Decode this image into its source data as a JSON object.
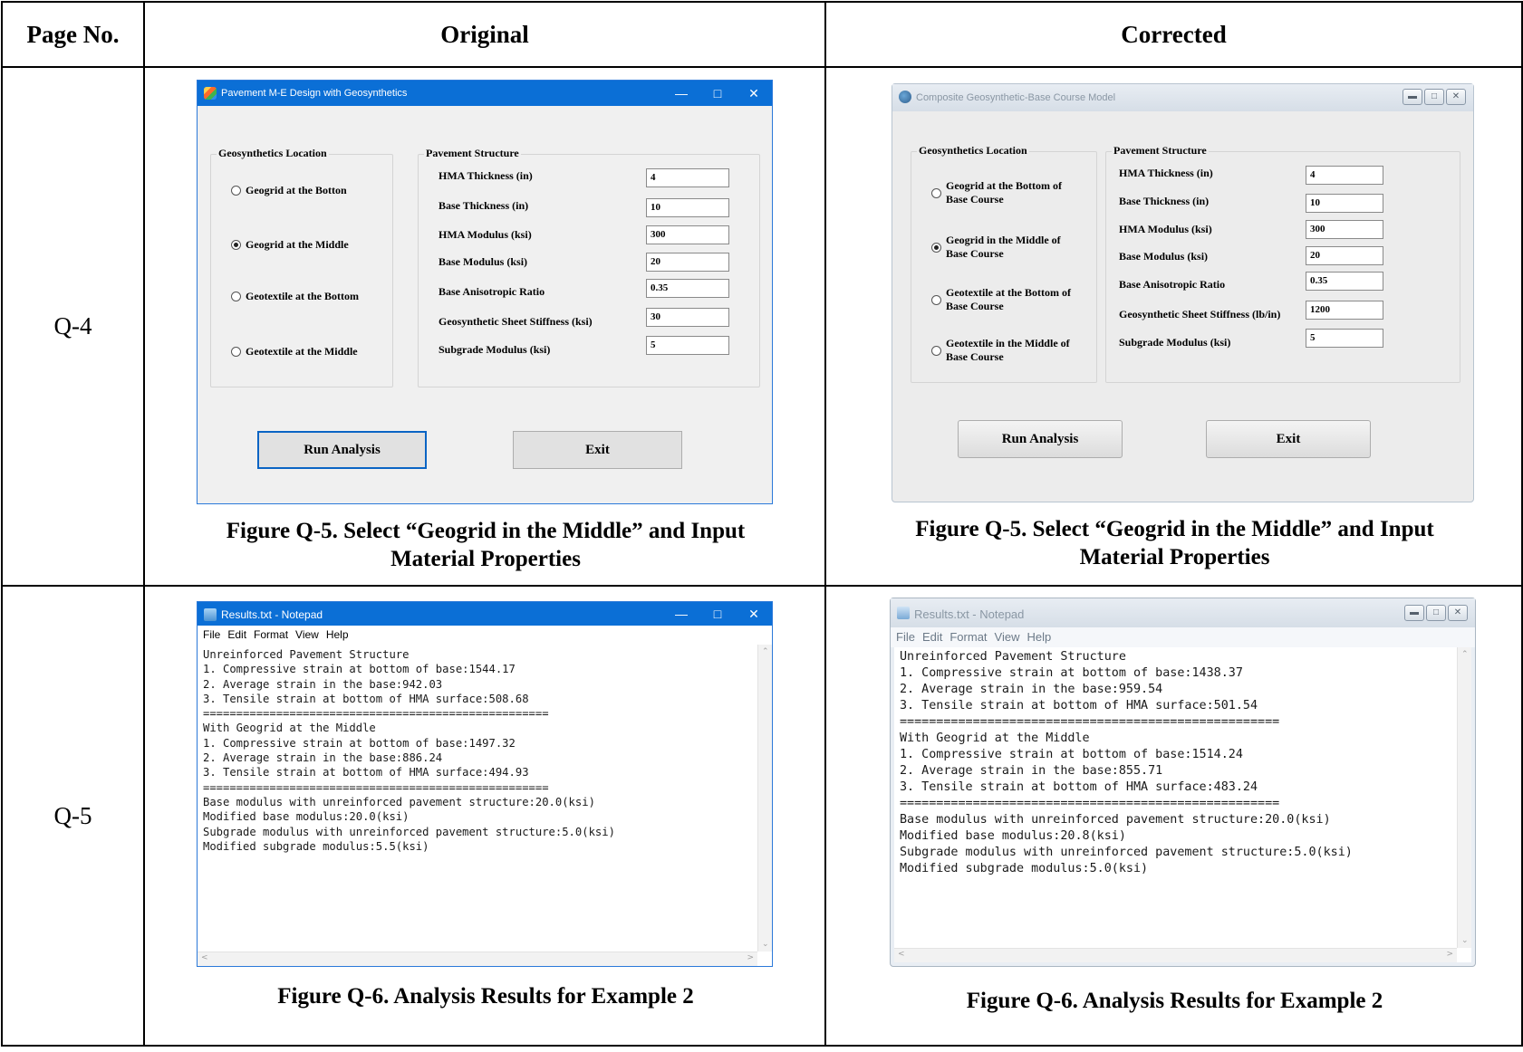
{
  "headers": {
    "page_no": "Page No.",
    "original": "Original",
    "corrected": "Corrected"
  },
  "rows": [
    {
      "page": "Q-4",
      "original": {
        "window_title": "Pavement M-E Design with Geosynthetics",
        "location_group": "Geosynthetics Location",
        "options": [
          "Geogrid at the Botton",
          "Geogrid at the Middle",
          "Geotextile at the Bottom",
          "Geotextile at the Middle"
        ],
        "selected_index": 1,
        "structure_group": "Pavement Structure",
        "labels": [
          "HMA Thickness (in)",
          "Base Thickness (in)",
          "HMA Modulus (ksi)",
          "Base Modulus (ksi)",
          "Base Anisotropic Ratio",
          "Geosynthetic Sheet Stiffness (ksi)",
          "Subgrade Modulus (ksi)"
        ],
        "values": [
          "4",
          "10",
          "300",
          "20",
          "0.35",
          "30",
          "5"
        ],
        "run_button": "Run Analysis",
        "exit_button": "Exit",
        "caption_line1": "Figure Q-5. Select “Geogrid in the Middle” and Input",
        "caption_line2": "Material Properties"
      },
      "corrected": {
        "window_title": "Composite Geosynthetic-Base Course Model",
        "location_group": "Geosynthetics Location",
        "options": [
          [
            "Geogrid at the Bottom of",
            "Base Course"
          ],
          [
            "Geogrid in the Middle of",
            "Base Course"
          ],
          [
            "Geotextile at the Bottom of",
            "Base Course"
          ],
          [
            "Geotextile in the Middle of",
            "Base Course"
          ]
        ],
        "selected_index": 1,
        "structure_group": "Pavement Structure",
        "labels": [
          "HMA Thickness (in)",
          "Base Thickness (in)",
          "HMA Modulus (ksi)",
          "Base Modulus (ksi)",
          "Base Anisotropic Ratio",
          "Geosynthetic Sheet Stiffness (lb/in)",
          "Subgrade Modulus (ksi)"
        ],
        "values": [
          "4",
          "10",
          "300",
          "20",
          "0.35",
          "1200",
          "5"
        ],
        "run_button": "Run Analysis",
        "exit_button": "Exit",
        "caption_line1": "Figure Q-5. Select “Geogrid in the Middle” and Input",
        "caption_line2": "Material Properties"
      }
    },
    {
      "page": "Q-5",
      "original": {
        "window_title": "Results.txt - Notepad",
        "menu": [
          "File",
          "Edit",
          "Format",
          "View",
          "Help"
        ],
        "lines": [
          "Unreinforced Pavement Structure",
          "1. Compressive strain at bottom of base:1544.17",
          "2. Average strain in the base:942.03",
          "3. Tensile strain at bottom of HMA surface:508.68",
          "====================================================",
          "With Geogrid at the Middle",
          "1. Compressive strain at bottom of base:1497.32",
          "2. Average strain in the base:886.24",
          "3. Tensile strain at bottom of HMA surface:494.93",
          "====================================================",
          "Base modulus with unreinforced pavement structure:20.0(ksi)",
          "Modified base modulus:20.0(ksi)",
          "Subgrade modulus with unreinforced pavement structure:5.0(ksi)",
          "Modified subgrade modulus:5.5(ksi)"
        ],
        "caption": "Figure Q-6. Analysis Results for Example 2"
      },
      "corrected": {
        "window_title": "Results.txt - Notepad",
        "menu": [
          "File",
          "Edit",
          "Format",
          "View",
          "Help"
        ],
        "lines": [
          "Unreinforced Pavement Structure",
          "1. Compressive strain at bottom of base:1438.37",
          "2. Average strain in the base:959.54",
          "3. Tensile strain at bottom of HMA surface:501.54",
          "====================================================",
          "With Geogrid at the Middle",
          "1. Compressive strain at bottom of base:1514.24",
          "2. Average strain in the base:855.71",
          "3. Tensile strain at bottom of HMA surface:483.24",
          "====================================================",
          "Base modulus with unreinforced pavement structure:20.0(ksi)",
          "Modified base modulus:20.8(ksi)",
          "Subgrade modulus with unreinforced pavement structure:5.0(ksi)",
          "Modified subgrade modulus:5.0(ksi)"
        ],
        "caption": "Figure Q-6. Analysis Results for Example 2"
      }
    }
  ]
}
